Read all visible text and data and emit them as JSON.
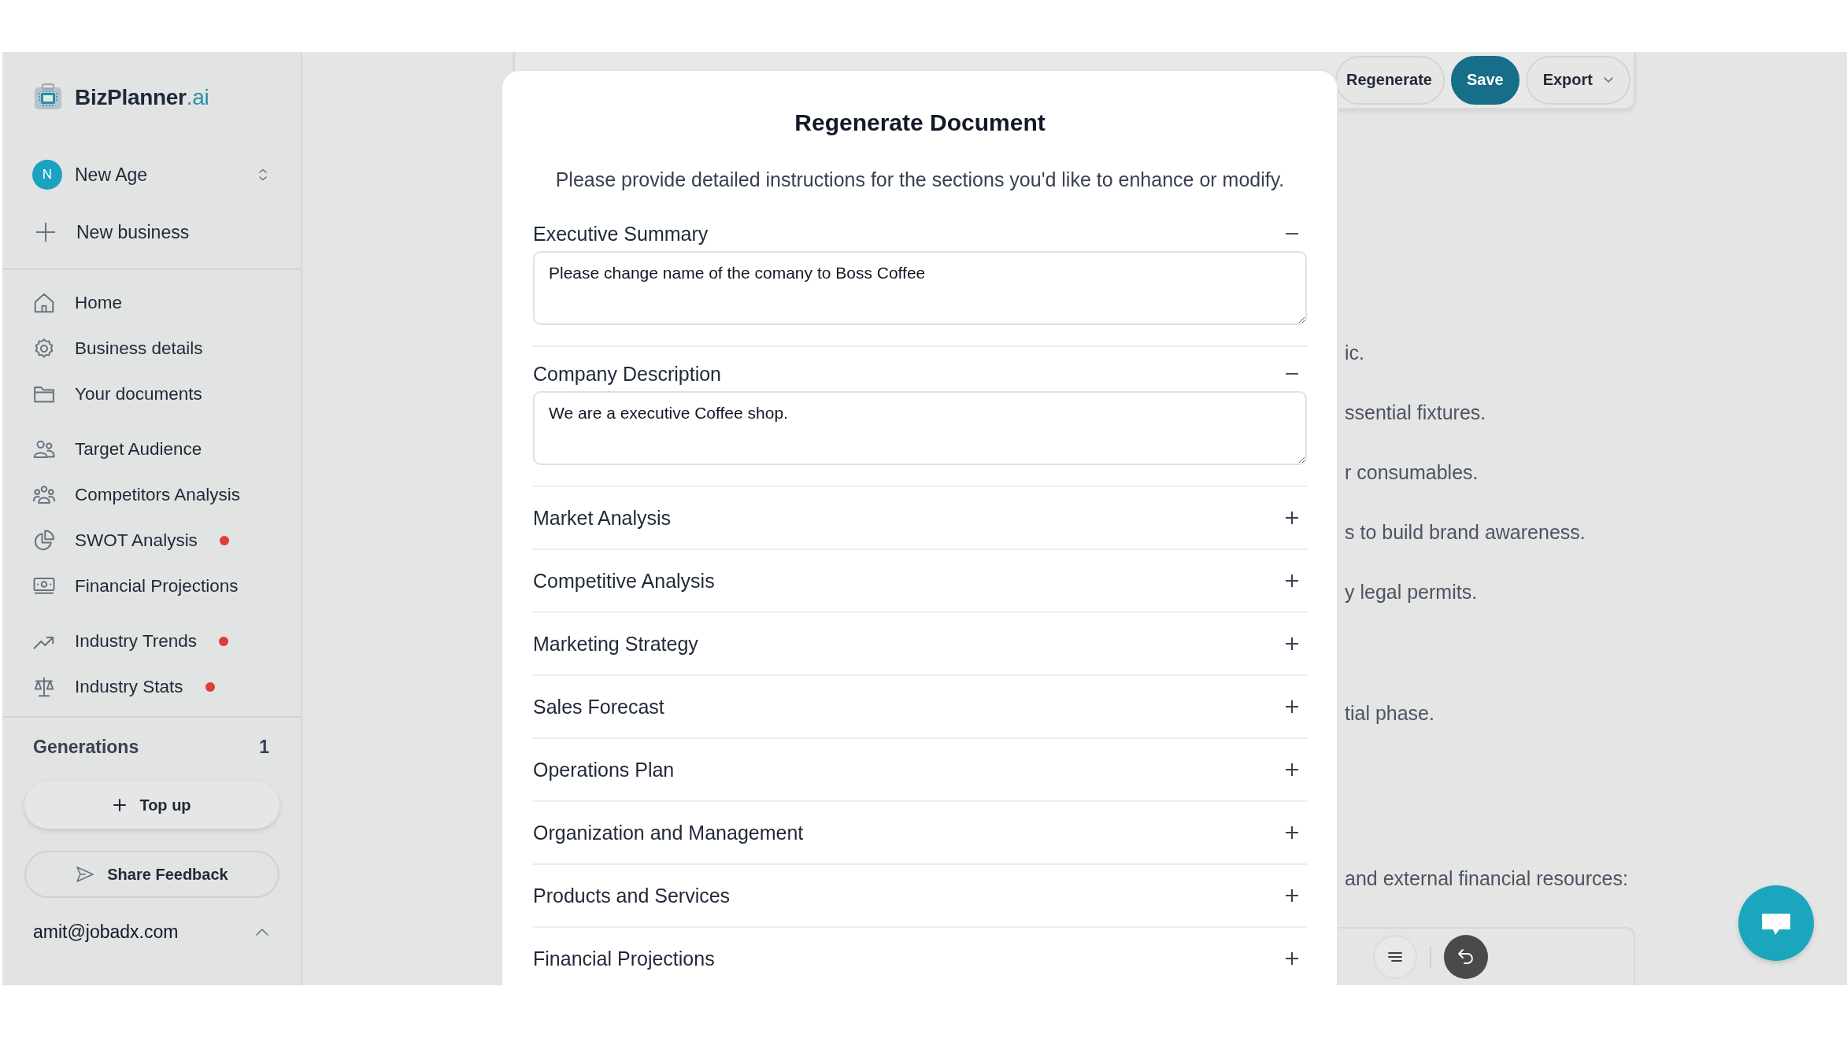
{
  "sidebar": {
    "logo": {
      "name": "BizPlanner",
      "suffix": ".ai"
    },
    "workspace": {
      "initial": "N",
      "name": "New Age"
    },
    "new_business": "New business",
    "nav_groups": [
      {
        "items": [
          {
            "label": "Home",
            "alert": false
          },
          {
            "label": "Business details",
            "alert": false
          },
          {
            "label": "Your documents",
            "alert": false
          }
        ]
      },
      {
        "items": [
          {
            "label": "Target Audience",
            "alert": false
          },
          {
            "label": "Competitors Analysis",
            "alert": false
          },
          {
            "label": "SWOT Analysis",
            "alert": true
          },
          {
            "label": "Financial Projections",
            "alert": false
          }
        ]
      },
      {
        "items": [
          {
            "label": "Industry Trends",
            "alert": true
          },
          {
            "label": "Industry Stats",
            "alert": true
          }
        ]
      }
    ],
    "generations": {
      "label": "Generations",
      "count": "1"
    },
    "top_up": "Top up",
    "share_feedback": "Share Feedback",
    "account": "amit@jobadx.com"
  },
  "toolbar": {
    "buttons": [
      {
        "label": "Regenerate",
        "kind": "outline"
      },
      {
        "label": "Save",
        "kind": "primary"
      },
      {
        "label": "Export",
        "kind": "dropdown"
      }
    ]
  },
  "document": {
    "lines": [
      "ic.",
      "ssential fixtures.",
      "r consumables.",
      "s to build brand awareness.",
      "y legal permits.",
      "tial phase.",
      "and external financial resources:"
    ]
  },
  "modal": {
    "title": "Regenerate Document",
    "subtitle": "Please provide detailed instructions for the sections you'd like to enhance or modify.",
    "sections": [
      {
        "title": "Executive Summary",
        "expanded": true,
        "instructions": "Please change name of the comany to Boss Coffee"
      },
      {
        "title": "Company Description",
        "expanded": true,
        "instructions": "We are a executive Coffee shop."
      },
      {
        "title": "Market Analysis",
        "expanded": false
      },
      {
        "title": "Competitive Analysis",
        "expanded": false
      },
      {
        "title": "Marketing Strategy",
        "expanded": false
      },
      {
        "title": "Sales Forecast",
        "expanded": false
      },
      {
        "title": "Operations Plan",
        "expanded": false
      },
      {
        "title": "Organization and Management",
        "expanded": false
      },
      {
        "title": "Products and Services",
        "expanded": false
      },
      {
        "title": "Financial Projections",
        "expanded": false
      }
    ]
  }
}
